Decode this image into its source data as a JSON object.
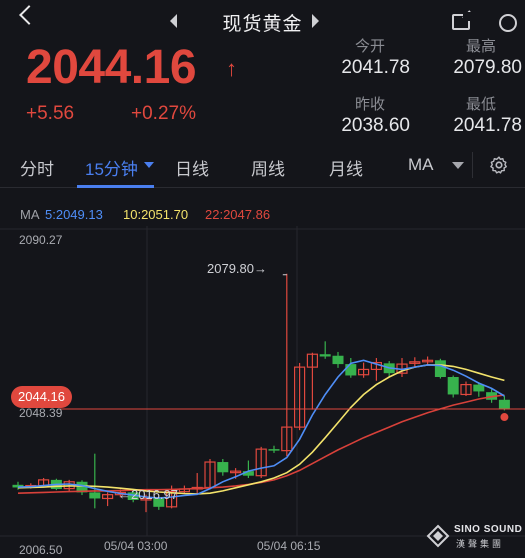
{
  "header": {
    "title": "现货黄金"
  },
  "quote": {
    "price": "2044.16",
    "change": "+5.56",
    "change_pct": "+0.27%",
    "open_label": "今开",
    "open": "2041.78",
    "high_label": "最高",
    "high": "2079.80",
    "prev_close_label": "昨收",
    "prev_close": "2038.60",
    "low_label": "最低",
    "low": "2041.78"
  },
  "tabs": {
    "time_share": "分时",
    "min15": "15分钟",
    "daily": "日线",
    "weekly": "周线",
    "monthly": "月线",
    "indicator": "MA"
  },
  "ma_legend": {
    "title": "MA",
    "ma5": "5:2049.13",
    "ma10": "10:2051.70",
    "ma22": "22:2047.86"
  },
  "colors": {
    "up": "#e0483e",
    "down": "#37b24d",
    "accent": "#4a7ff0",
    "ma5": "#4f8ef7",
    "ma10": "#f3e36b",
    "ma22": "#d8413a"
  },
  "chart_data": {
    "type": "candlestick",
    "y_axis_labels": [
      "2090.27",
      "2048.39",
      "2006.50"
    ],
    "x_axis_labels": [
      "05/04 03:00",
      "05/04 06:15"
    ],
    "current_price_tag": "2044.16",
    "max_annotation": "2079.80",
    "min_annotation": "2016.97",
    "ylim": [
      2006.5,
      2090.27
    ],
    "candles": [
      {
        "o": 2024.2,
        "c": 2023.5,
        "h": 2025.0,
        "l": 2022.9
      },
      {
        "o": 2023.6,
        "c": 2024.0,
        "h": 2024.6,
        "l": 2023.2
      },
      {
        "o": 2024.0,
        "c": 2025.5,
        "h": 2026.0,
        "l": 2023.7
      },
      {
        "o": 2025.5,
        "c": 2023.1,
        "h": 2025.8,
        "l": 2022.8
      },
      {
        "o": 2023.2,
        "c": 2025.0,
        "h": 2025.5,
        "l": 2022.5
      },
      {
        "o": 2025.0,
        "c": 2022.2,
        "h": 2025.4,
        "l": 2021.5
      },
      {
        "o": 2022.2,
        "c": 2020.6,
        "h": 2032.4,
        "l": 2018.0
      },
      {
        "o": 2020.6,
        "c": 2021.6,
        "h": 2022.2,
        "l": 2018.6
      },
      {
        "o": 2021.6,
        "c": 2022.2,
        "h": 2023.0,
        "l": 2020.9
      },
      {
        "o": 2022.2,
        "c": 2020.2,
        "h": 2022.6,
        "l": 2019.6
      },
      {
        "o": 2020.2,
        "c": 2020.6,
        "h": 2021.6,
        "l": 2017.0
      },
      {
        "o": 2020.6,
        "c": 2018.4,
        "h": 2021.0,
        "l": 2017.6
      },
      {
        "o": 2018.4,
        "c": 2022.4,
        "h": 2024.0,
        "l": 2018.0
      },
      {
        "o": 2022.4,
        "c": 2023.1,
        "h": 2024.0,
        "l": 2021.8
      },
      {
        "o": 2023.1,
        "c": 2023.5,
        "h": 2027.3,
        "l": 2021.5
      },
      {
        "o": 2023.5,
        "c": 2030.2,
        "h": 2031.0,
        "l": 2023.0
      },
      {
        "o": 2030.2,
        "c": 2027.5,
        "h": 2031.0,
        "l": 2026.6
      },
      {
        "o": 2027.5,
        "c": 2027.8,
        "h": 2028.6,
        "l": 2025.8
      },
      {
        "o": 2027.8,
        "c": 2026.6,
        "h": 2030.6,
        "l": 2026.0
      },
      {
        "o": 2026.6,
        "c": 2033.6,
        "h": 2034.2,
        "l": 2026.0
      },
      {
        "o": 2033.6,
        "c": 2033.2,
        "h": 2034.5,
        "l": 2032.6
      },
      {
        "o": 2033.2,
        "c": 2039.4,
        "h": 2079.8,
        "l": 2031.8
      },
      {
        "o": 2039.4,
        "c": 2055.2,
        "h": 2056.3,
        "l": 2038.6
      },
      {
        "o": 2055.2,
        "c": 2058.6,
        "h": 2059.0,
        "l": 2044.0
      },
      {
        "o": 2058.6,
        "c": 2058.0,
        "h": 2062.0,
        "l": 2057.4
      },
      {
        "o": 2058.2,
        "c": 2056.0,
        "h": 2059.2,
        "l": 2055.0
      },
      {
        "o": 2056.0,
        "c": 2053.0,
        "h": 2057.6,
        "l": 2052.4
      },
      {
        "o": 2053.2,
        "c": 2054.6,
        "h": 2056.4,
        "l": 2052.4
      },
      {
        "o": 2054.6,
        "c": 2056.4,
        "h": 2057.6,
        "l": 2051.6
      },
      {
        "o": 2056.2,
        "c": 2053.6,
        "h": 2056.8,
        "l": 2052.6
      },
      {
        "o": 2053.6,
        "c": 2056.0,
        "h": 2057.6,
        "l": 2052.6
      },
      {
        "o": 2056.2,
        "c": 2056.6,
        "h": 2057.8,
        "l": 2055.2
      },
      {
        "o": 2056.8,
        "c": 2057.0,
        "h": 2058.0,
        "l": 2055.6
      },
      {
        "o": 2057.0,
        "c": 2052.6,
        "h": 2057.4,
        "l": 2052.2
      },
      {
        "o": 2052.6,
        "c": 2048.0,
        "h": 2053.0,
        "l": 2047.2
      },
      {
        "o": 2048.0,
        "c": 2050.6,
        "h": 2051.4,
        "l": 2047.6
      },
      {
        "o": 2050.6,
        "c": 2048.8,
        "h": 2051.2,
        "l": 2047.4
      },
      {
        "o": 2048.6,
        "c": 2046.6,
        "h": 2049.4,
        "l": 2045.8
      },
      {
        "o": 2046.6,
        "c": 2044.16,
        "h": 2047.6,
        "l": 2043.8
      }
    ],
    "ma5": [
      2023.6,
      2023.7,
      2024.0,
      2024.3,
      2024.4,
      2024.0,
      2023.2,
      2022.5,
      2021.9,
      2021.5,
      2021.0,
      2020.7,
      2021.0,
      2021.4,
      2021.7,
      2023.2,
      2025.0,
      2026.3,
      2027.8,
      2028.6,
      2029.2,
      2031.4,
      2036.2,
      2042.6,
      2048.0,
      2052.6,
      2056.2,
      2057.0,
      2056.0,
      2055.0,
      2054.6,
      2055.2,
      2055.8,
      2055.6,
      2054.4,
      2052.8,
      2051.0,
      2049.6,
      2047.6
    ],
    "ma10": [
      2023.4,
      2023.5,
      2023.6,
      2023.8,
      2023.9,
      2023.9,
      2023.8,
      2023.6,
      2023.3,
      2023.0,
      2022.6,
      2022.3,
      2022.1,
      2021.9,
      2021.8,
      2022.0,
      2022.6,
      2023.4,
      2024.2,
      2025.0,
      2026.0,
      2027.4,
      2029.6,
      2032.8,
      2036.6,
      2040.6,
      2044.6,
      2048.0,
      2050.6,
      2052.6,
      2054.2,
      2055.2,
      2055.8,
      2055.8,
      2055.4,
      2054.6,
      2053.6,
      2052.6,
      2051.7
    ],
    "ma22": [
      2022.0,
      2022.1,
      2022.2,
      2022.3,
      2022.4,
      2022.5,
      2022.6,
      2022.6,
      2022.7,
      2022.8,
      2022.9,
      2022.9,
      2023.0,
      2023.1,
      2023.2,
      2023.4,
      2023.6,
      2023.9,
      2024.3,
      2024.8,
      2025.5,
      2026.6,
      2028.0,
      2029.8,
      2031.6,
      2033.4,
      2035.0,
      2036.6,
      2038.0,
      2039.4,
      2040.8,
      2042.0,
      2043.2,
      2044.2,
      2045.2,
      2046.0,
      2046.8,
      2047.4,
      2047.86
    ]
  }
}
